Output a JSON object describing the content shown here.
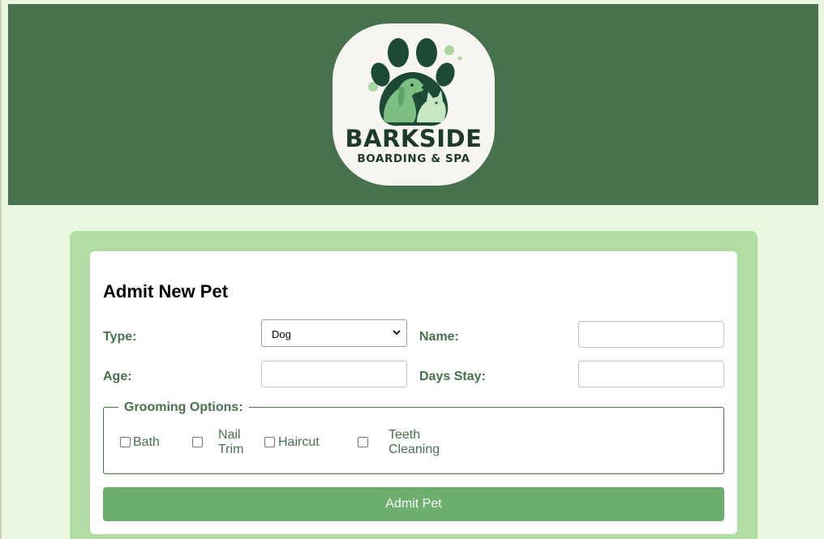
{
  "brand": {
    "name": "BARKSIDE",
    "tagline": "BOARDING & SPA"
  },
  "form": {
    "title": "Admit New Pet",
    "type_label": "Type:",
    "type_value": "Dog",
    "name_label": "Name:",
    "name_value": "",
    "age_label": "Age:",
    "age_value": "",
    "days_label": "Days Stay:",
    "days_value": "",
    "grooming": {
      "legend": "Grooming Options:",
      "options": [
        {
          "label": "Bath",
          "checked": false
        },
        {
          "label": "Nail Trim",
          "checked": false
        },
        {
          "label": "Haircut",
          "checked": false
        },
        {
          "label": "Teeth Cleaning",
          "checked": false
        }
      ]
    },
    "submit_label": "Admit Pet"
  },
  "colors": {
    "header_bg": "#48714e",
    "page_bg": "#e8f7dd",
    "panel_bg": "#b1dda5",
    "accent": "#6bae6e",
    "label": "#48714e"
  },
  "icons": {
    "logo": "paw-dog-cat-icon",
    "select_arrow": "chevron-down-icon"
  }
}
